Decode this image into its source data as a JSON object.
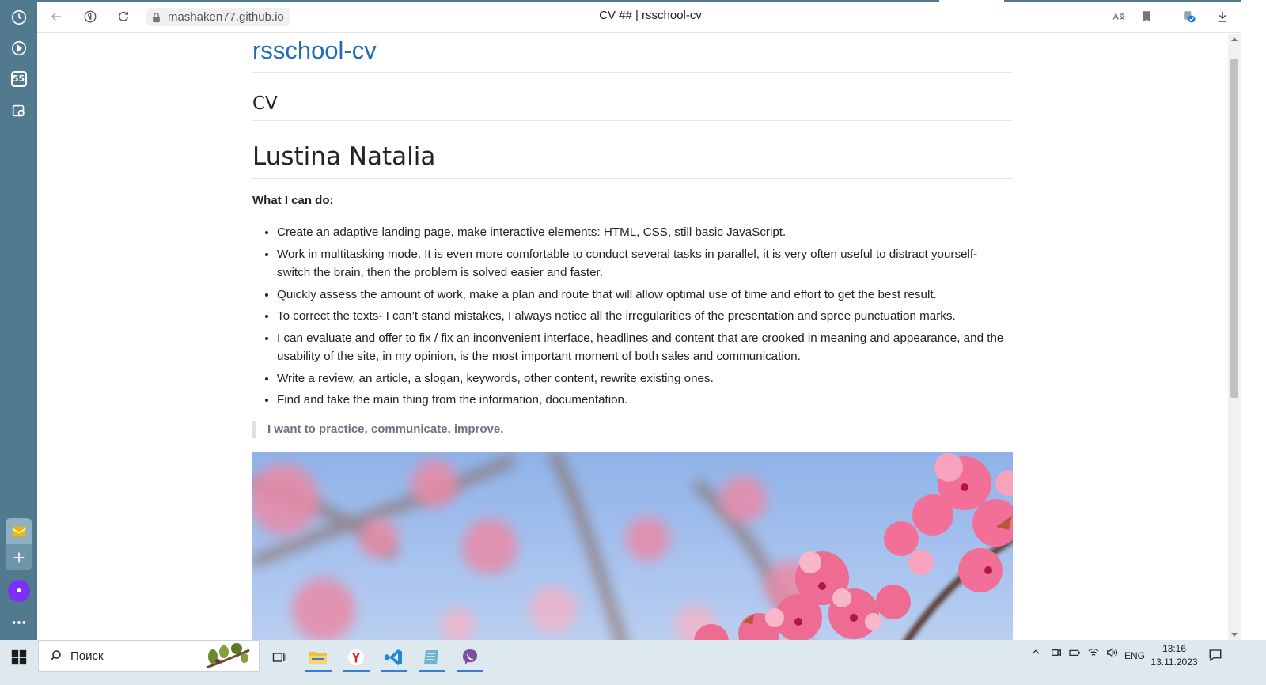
{
  "browser": {
    "url": "mashaken77.github.io",
    "tab_title": "CV ## | rsschool-cv",
    "sidebar_badge": "55"
  },
  "page": {
    "site_title": "rsschool-cv",
    "section_heading": "CV",
    "name_heading": "Lustina Natalia",
    "skills_label": "What I can do:",
    "skills": [
      "Create an adaptive landing page, make interactive elements: HTML, CSS, still basic JavaScript.",
      "Work in multitasking mode. It is even more comfortable to conduct several tasks in parallel, it is very often useful to distract yourself- switch the brain, then the problem is solved easier and faster.",
      "Quickly assess the amount of work, make a plan and route that will allow optimal use of time and effort to get the best result.",
      "To correct the texts- I can’t stand mistakes, I always notice all the irregularities of the presentation and spree punctuation marks.",
      "I can evaluate and offer to fix / fix an inconvenient interface, headlines and content that are crooked in meaning and appearance, and the usability of the site, in my opinion, is the most important moment of both sales and communication.",
      "Write a review, an article, a slogan, keywords, other content, rewrite existing ones.",
      "Find and take the main thing from the information, documentation."
    ],
    "quote": "I want to practice, communicate, improve."
  },
  "taskbar": {
    "search_placeholder": "Поиск",
    "language": "ENG",
    "time": "13:16",
    "date": "13.11.2023"
  },
  "colors": {
    "sidebar": "#517a8e",
    "link": "#1e6bb8",
    "taskbar": "#dde8ef"
  }
}
